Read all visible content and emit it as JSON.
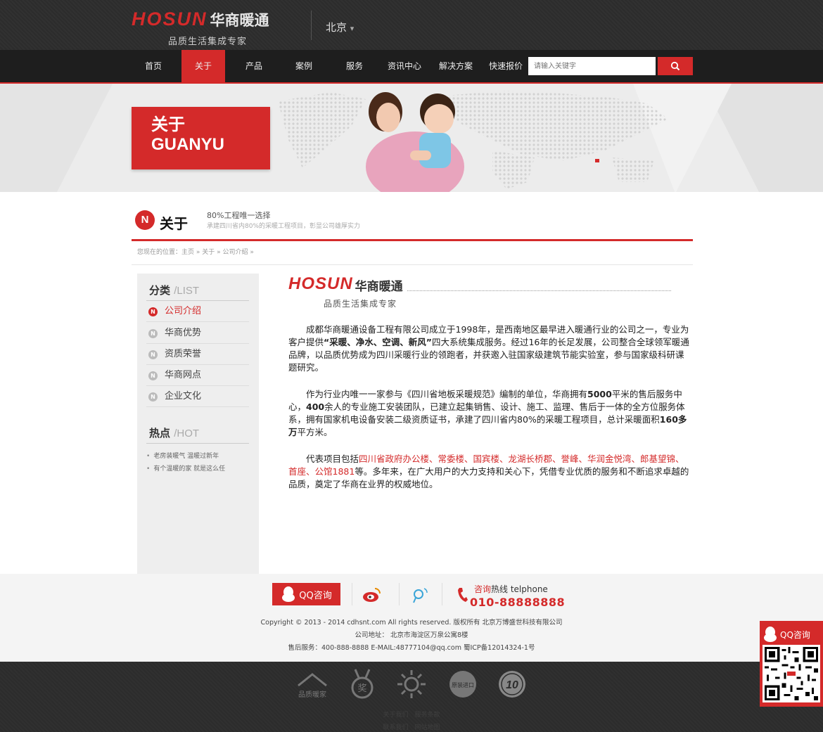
{
  "header": {
    "logo_en": "HOSUN",
    "logo_cn": "华商暖通",
    "slogan": "品质生活集成专家",
    "city": "北京",
    "city_arrow": "▾"
  },
  "nav": {
    "items": [
      {
        "label": "首页"
      },
      {
        "label": "关于"
      },
      {
        "label": "产品"
      },
      {
        "label": "案例"
      },
      {
        "label": "服务"
      },
      {
        "label": "资讯中心"
      },
      {
        "label": "解决方案"
      },
      {
        "label": "快速报价"
      }
    ],
    "active_index": 1,
    "search_placeholder": "请输入关键字"
  },
  "banner": {
    "title_cn": "关于",
    "title_en": "GUANYU"
  },
  "section": {
    "badge": "N",
    "title": "关于",
    "tagline": "80%工程唯一选择",
    "tagline_sub": "承建四川省内80%的采暖工程项目，彰显公司雄厚实力"
  },
  "breadcrumb": {
    "text": "您现在的位置：主页 » 关于 » 公司介绍 »"
  },
  "sidebar": {
    "category_title": "分类",
    "category_en": "/LIST",
    "items": [
      {
        "label": "公司介绍",
        "active": true
      },
      {
        "label": "华商优势"
      },
      {
        "label": "资质荣誉"
      },
      {
        "label": "华商网点"
      },
      {
        "label": "企业文化"
      }
    ],
    "hot_title": "热点",
    "hot_en": "/HOT",
    "hot_items": [
      {
        "label": "老房装暖气 温暖过新年"
      },
      {
        "label": "有个温暖的家 就是这么任"
      }
    ]
  },
  "content": {
    "logo_en": "HOSUN",
    "logo_cn": "华商暖通",
    "logo_sub": "品质生活集成专家",
    "p1_a": "成都华商暖通设备工程有限公司成立于1998年，是西南地区最早进入暖通行业的公司之一，专业为客户提供",
    "p1_b": "“采暖、净水、空调、新风”",
    "p1_c": "四大系统集成服务。经过16年的长足发展，公司整合全球领军暖通品牌，以品质优势成为四川采暖行业的领跑者，并获邀入驻国家级建筑节能实验室，参与国家级科研课题研究。",
    "p2_a": "作为行业内唯一一家参与《四川省地板采暖规范》编制的单位，华商拥有",
    "p2_b": "5000",
    "p2_c": "平米的售后服务中心，",
    "p2_d": "400",
    "p2_e": "余人的专业施工安装团队，已建立起集销售、设计、施工、监理、售后于一体的全方位服务体系，拥有国家机电设备安装二级资质证书，承建了四川省内80%的采暖工程项目，总计采暖面积",
    "p2_f": "160多万",
    "p2_g": "平方米。",
    "p3_a": "代表项目包括",
    "p3_b": "四川省政府办公楼、常委楼、国宾楼、龙湖长桥郡、誉峰、华润金悦湾、郎基望锦、首座、公馆1881",
    "p3_c": "等。多年来，在广大用户的大力支持和关心下，凭借专业优质的服务和不断追求卓越的品质，奠定了华商在业界的权威地位。"
  },
  "footer": {
    "qq_label": "QQ咨询",
    "hotline_red": "咨询",
    "hotline_label": "热线 telphone",
    "hotline_number": "010-88888888",
    "copyright": "Copyright © 2013 - 2014 cdhsnt.com All rights reserved. 版权所有 北京万博盛世科技有限公司",
    "address": "公司地址： 北京市海淀区万泉公寓8楼",
    "service": "售后服务：400-888-8888 E-MAIL:48777104@qq.com 蜀ICP备12014324-1号",
    "badges": [
      "品质暖家",
      "奖",
      "",
      "原装进口",
      "10"
    ],
    "link_row1": "关于我们　服务条款",
    "link_row2": "联系我们　网站地图"
  },
  "float": {
    "qq_label": "QQ咨询"
  },
  "colors": {
    "brand_red": "#d42a2a",
    "header_dark": "#2c2c2c",
    "nav_dark": "#1e1e1e"
  }
}
